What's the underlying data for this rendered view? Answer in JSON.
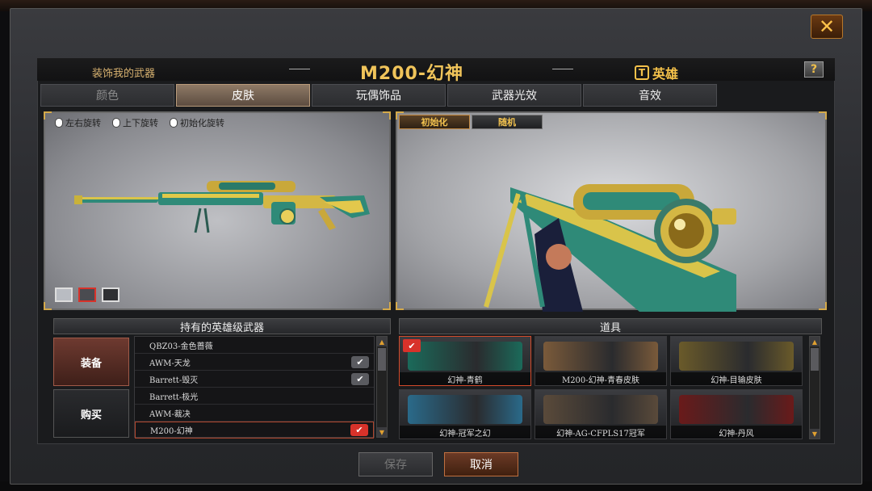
{
  "header": {
    "decorate_label": "装饰我的武器",
    "weapon_title": "M200-幻神",
    "hero_label": "英雄",
    "help_label": "?",
    "close_label": "✕"
  },
  "tabs": [
    {
      "label": "颜色",
      "state": "disabled"
    },
    {
      "label": "皮肤",
      "state": "active"
    },
    {
      "label": "玩偶饰品",
      "state": "normal"
    },
    {
      "label": "武器光效",
      "state": "normal"
    },
    {
      "label": "音效",
      "state": "normal"
    }
  ],
  "left_view": {
    "hints": [
      "左右旋转",
      "上下旋转",
      "初始化旋转"
    ],
    "swatch_colors": [
      "#b9bcc2",
      "#4a4b50",
      "#2f3033"
    ],
    "selected_swatch": 1
  },
  "right_view": {
    "buttons": [
      "初始化",
      "随机"
    ]
  },
  "owned_section": {
    "title": "持有的英雄级武器",
    "equip_label": "装备",
    "buy_label": "购买",
    "weapons": [
      {
        "name": "QBZ03-金色蔷薇",
        "checked": false,
        "selected": false
      },
      {
        "name": "AWM-天龙",
        "checked": true,
        "selected": false
      },
      {
        "name": "Barrett-毁灭",
        "checked": true,
        "selected": false
      },
      {
        "name": "Barrett-极光",
        "checked": false,
        "selected": false
      },
      {
        "name": "AWM-裁决",
        "checked": false,
        "selected": false
      },
      {
        "name": "M200-幻神",
        "checked": true,
        "selected": true
      }
    ]
  },
  "items_section": {
    "title": "道具",
    "items": [
      {
        "name": "幻神-青鹤",
        "selected": true,
        "color": "#1b6a5a"
      },
      {
        "name": "M200-幻神-青春皮肤",
        "selected": false,
        "color": "#7a5a3a"
      },
      {
        "name": "幻神-目输皮肤",
        "selected": false,
        "color": "#6a5a2a"
      },
      {
        "name": "幻神-冠军之幻",
        "selected": false,
        "color": "#2a6a8a"
      },
      {
        "name": "幻神-AG-CFPLS17冠军",
        "selected": false,
        "color": "#5a4a3a"
      },
      {
        "name": "幻神-丹风",
        "selected": false,
        "color": "#6a1a1a"
      }
    ]
  },
  "footer": {
    "save_label": "保存",
    "cancel_label": "取消"
  }
}
